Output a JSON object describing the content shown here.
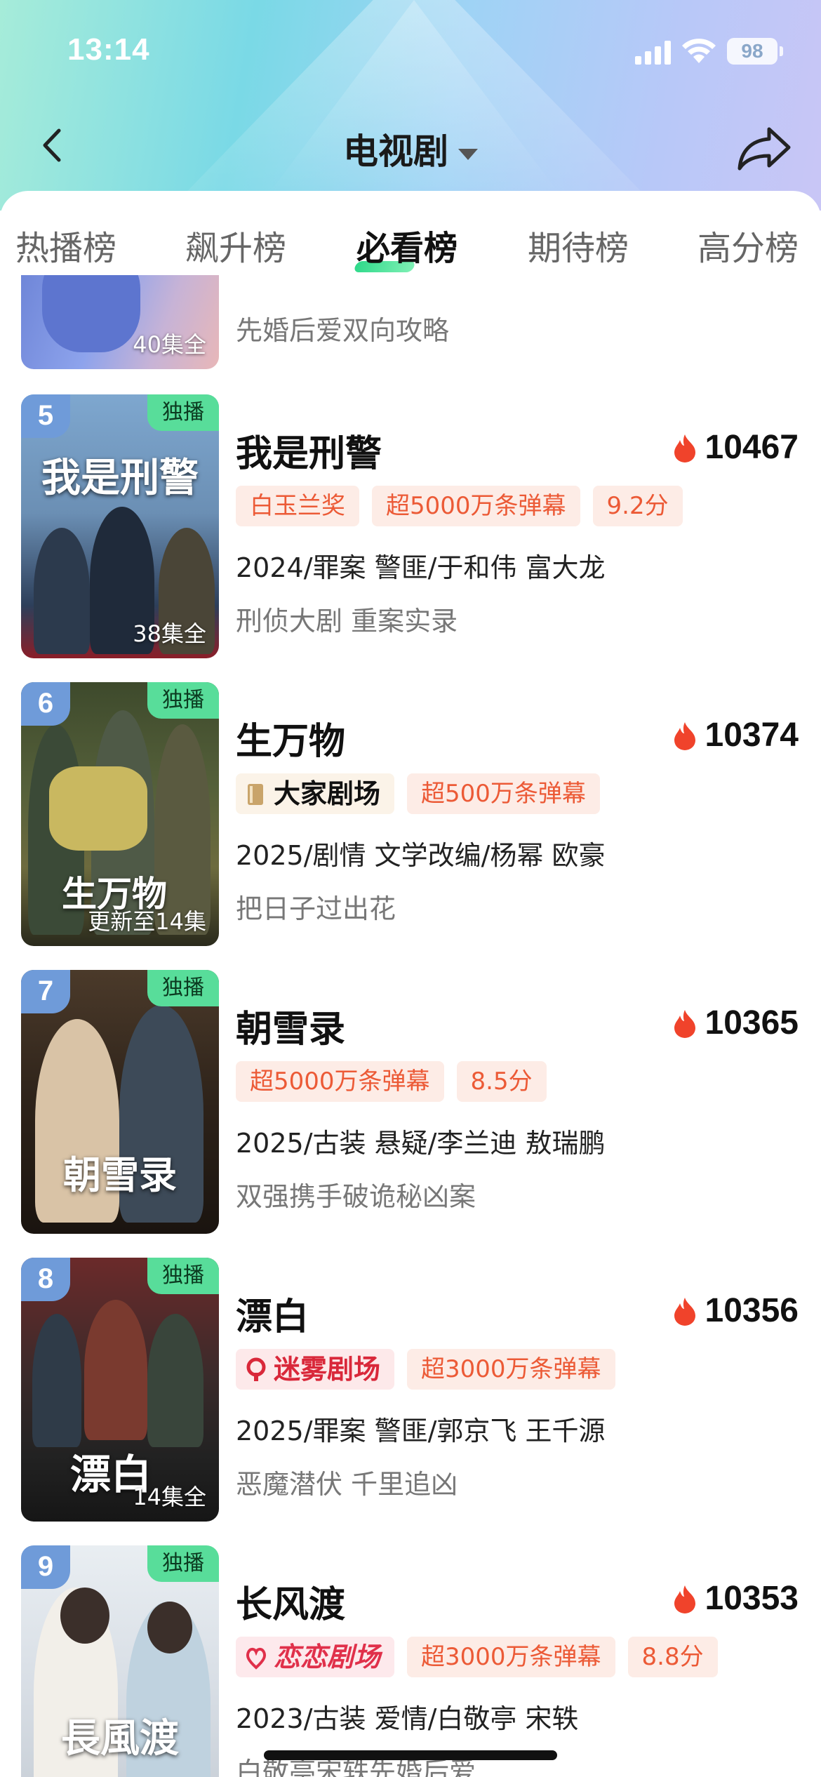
{
  "status_bar": {
    "time": "13:14",
    "battery": "98"
  },
  "nav": {
    "title": "电视剧"
  },
  "tabs": [
    {
      "label": "热播榜",
      "active": false
    },
    {
      "label": "飙升榜",
      "active": false
    },
    {
      "label": "必看榜",
      "active": true
    },
    {
      "label": "期待榜",
      "active": false
    },
    {
      "label": "高分榜",
      "active": false
    }
  ],
  "partial_item": {
    "episodes": "40集全",
    "desc": "先婚后爱双向攻略"
  },
  "items": [
    {
      "rank": "5",
      "badge": "独播",
      "episodes": "38集全",
      "poster_title": "我是刑警",
      "title": "我是刑警",
      "heat": "10467",
      "tags": [
        "白玉兰奖",
        "超5000万条弹幕",
        "9.2分"
      ],
      "meta": "2024/罪案 警匪/于和伟 富大龙",
      "desc": "刑侦大剧 重案实录"
    },
    {
      "rank": "6",
      "badge": "独播",
      "episodes": "更新至14集",
      "poster_title": "生万物",
      "title": "生万物",
      "heat": "10374",
      "tags": [
        "大家剧场",
        "超500万条弹幕"
      ],
      "meta": "2025/剧情 文学改编/杨幂 欧豪",
      "desc": "把日子过出花"
    },
    {
      "rank": "7",
      "badge": "独播",
      "episodes": "",
      "poster_title": "朝雪录",
      "title": "朝雪录",
      "heat": "10365",
      "tags": [
        "超5000万条弹幕",
        "8.5分"
      ],
      "meta": "2025/古装 悬疑/李兰迪 敖瑞鹏",
      "desc": "双强携手破诡秘凶案"
    },
    {
      "rank": "8",
      "badge": "独播",
      "episodes": "14集全",
      "poster_title": "漂白",
      "title": "漂白",
      "heat": "10356",
      "tags": [
        "迷雾剧场",
        "超3000万条弹幕"
      ],
      "meta": "2025/罪案 警匪/郭京飞 王千源",
      "desc": "恶魔潜伏 千里追凶"
    },
    {
      "rank": "9",
      "badge": "独播",
      "episodes": "",
      "poster_title": "長風渡",
      "title": "长风渡",
      "heat": "10353",
      "tags": [
        "恋恋剧场",
        "超3000万条弹幕",
        "8.8分"
      ],
      "meta": "2023/古装 爱情/白敬亭 宋轶",
      "desc": "白敬亭宋轶先婚后爱"
    }
  ],
  "colors": {
    "tag_text": "#ec5a36",
    "tag_bg": "#fdece6",
    "rank_badge": "#6f9bd9",
    "exclusive_badge": "#58dd9a",
    "flame": "#f0432b"
  }
}
